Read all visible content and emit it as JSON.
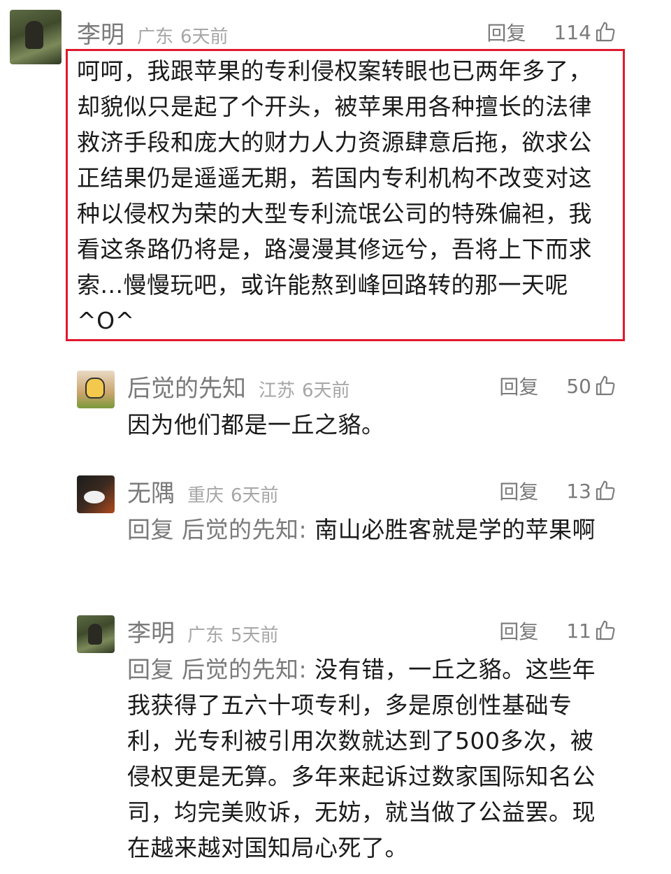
{
  "comments": [
    {
      "username": "李明",
      "location": "广东",
      "time": "6天前",
      "reply_label": "回复",
      "likes": "114",
      "text": "呵呵，我跟苹果的专利侵权案转眼也已两年多了，却貌似只是起了个开头，被苹果用各种擅长的法律救济手段和庞大的财力人力资源肆意后拖，欲求公正结果仍是遥遥无期，若国内专利机构不改变对这种以侵权为荣的大型专利流氓公司的特殊偏袒，我看这条路仍将是，路漫漫其修远兮，吾将上下而求索...慢慢玩吧，或许能熬到峰回路转的那一天呢^O^",
      "highlighted": true
    },
    {
      "username": "后觉的先知",
      "location": "江苏",
      "time": "6天前",
      "reply_label": "回复",
      "likes": "50",
      "text": "因为他们都是一丘之貉。"
    },
    {
      "username": "无隅",
      "location": "重庆",
      "time": "6天前",
      "reply_label": "回复",
      "likes": "13",
      "reply_prefix": "回复",
      "reply_to": "后觉的先知:",
      "text": "南山必胜客就是学的苹果啊"
    },
    {
      "username": "李明",
      "location": "广东",
      "time": "5天前",
      "reply_label": "回复",
      "likes": "11",
      "reply_prefix": "回复",
      "reply_to": "后觉的先知:",
      "text": "没有错，一丘之貉。这些年我获得了五六十项专利，多是原创性基础专利，光专利被引用次数就达到了500多次，被侵权更是无算。多年来起诉过数家国际知名公司，均完美败诉，无妨，就当做了公益罢。现在越来越对国知局心死了。"
    }
  ],
  "icons": {
    "like": "thumbs-up-icon"
  },
  "colors": {
    "highlight_border": "#e0182d",
    "muted_text": "#7a7a7a"
  }
}
